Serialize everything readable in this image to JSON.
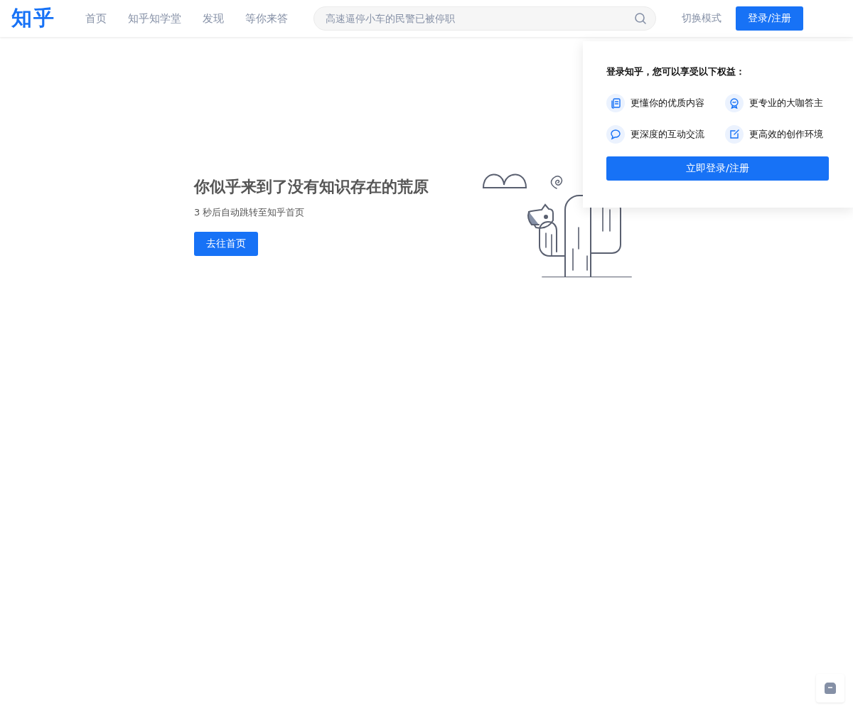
{
  "header": {
    "logo": "知乎",
    "nav": [
      "首页",
      "知乎知学堂",
      "发现",
      "等你来答"
    ],
    "search": {
      "placeholder": "高速逼停小车的民警已被停职"
    },
    "mode_toggle": "切换模式",
    "login_button": "登录/注册"
  },
  "login_popup": {
    "title": "登录知乎，您可以享受以下权益：",
    "benefits": [
      {
        "kind": "content",
        "label": "更懂你的优质内容"
      },
      {
        "kind": "expert",
        "label": "更专业的大咖答主"
      },
      {
        "kind": "chat",
        "label": "更深度的互动交流"
      },
      {
        "kind": "edit",
        "label": "更高效的创作环境"
      }
    ],
    "button": "立即登录/注册"
  },
  "error": {
    "title": "你似乎来到了没有知识存在的荒原",
    "subtitle": "3 秒后自动跳转至知乎首页",
    "button": "去往首页"
  }
}
